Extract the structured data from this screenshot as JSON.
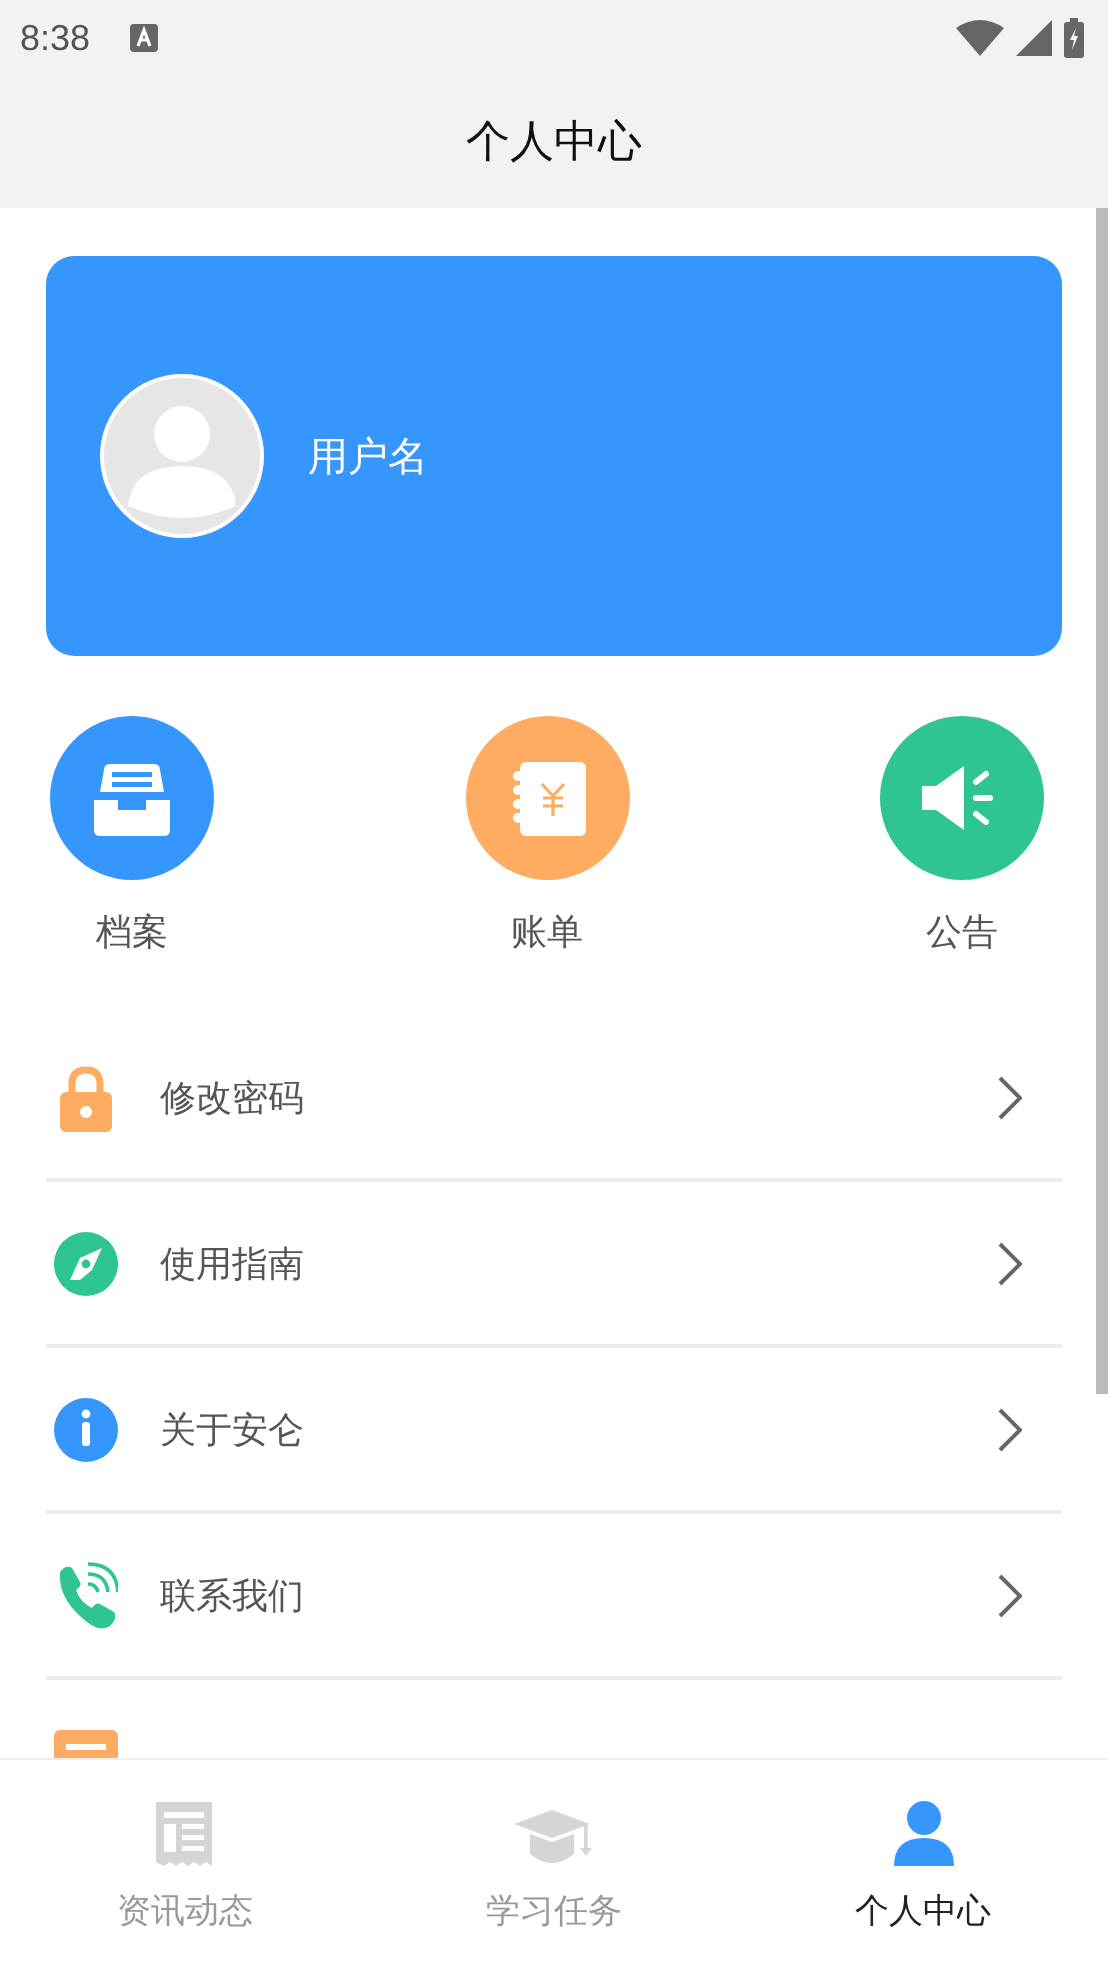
{
  "status_bar": {
    "time": "8:38"
  },
  "header": {
    "title": "个人中心"
  },
  "profile": {
    "username": "用户名"
  },
  "quick_actions": [
    {
      "label": "档案",
      "color": "#3596fe"
    },
    {
      "label": "账单",
      "color": "#fdac62"
    },
    {
      "label": "公告",
      "color": "#2ec593"
    }
  ],
  "menu": [
    {
      "label": "修改密码"
    },
    {
      "label": "使用指南"
    },
    {
      "label": "关于安仑"
    },
    {
      "label": "联系我们"
    }
  ],
  "tabs": [
    {
      "label": "资讯动态",
      "selected": false
    },
    {
      "label": "学习任务",
      "selected": false
    },
    {
      "label": "个人中心",
      "selected": true
    }
  ]
}
